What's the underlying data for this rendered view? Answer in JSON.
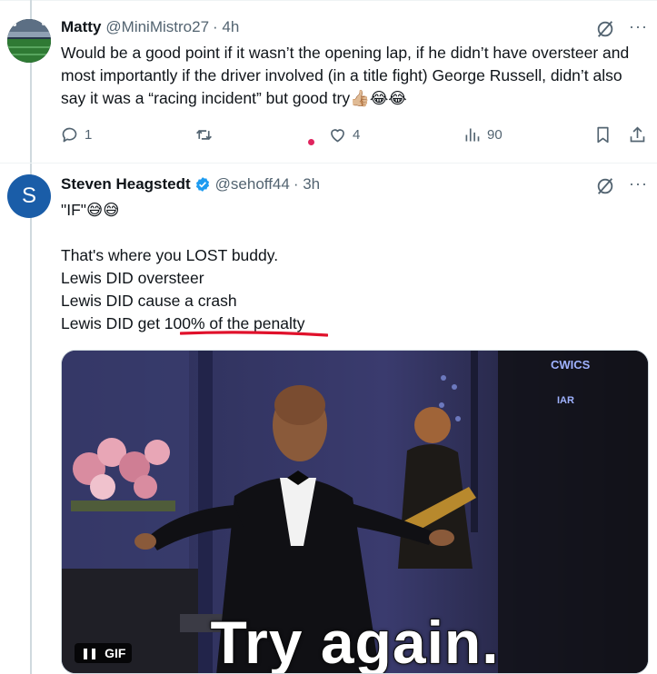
{
  "tweet1": {
    "name": "Matty",
    "handle": "@MiniMistro27",
    "time": "· 4h",
    "text": "Would be a good point if it wasn’t the opening lap, if he didn’t have oversteer and most importantly if the driver involved (in a title fight) George Russell, didn’t also say it was a “racing incident” but good try👍🏼😂😂",
    "replies": "1",
    "retweets": "",
    "likes": "4",
    "views": "90",
    "more_label": "···"
  },
  "tweet2": {
    "avatar_letter": "S",
    "name": "Steven Heagstedt",
    "handle": "@sehoff44",
    "time": "· 3h",
    "line1": "\"IF\"😅😅",
    "line2": "That's where you LOST buddy.",
    "line3": "Lewis DID oversteer",
    "line4": "Lewis DID cause a crash",
    "line5": "Lewis DID get 100% of the penalty",
    "more_label": "···",
    "gif": {
      "caption": "Try again.",
      "badge": "GIF",
      "pause_icon": "❚❚",
      "sign_text": "CWICS",
      "sign_text2": "IAR"
    }
  },
  "colors": {
    "accent": "#1d9bf0",
    "secondary_text": "#536471",
    "annotation_red": "#e0112b"
  }
}
